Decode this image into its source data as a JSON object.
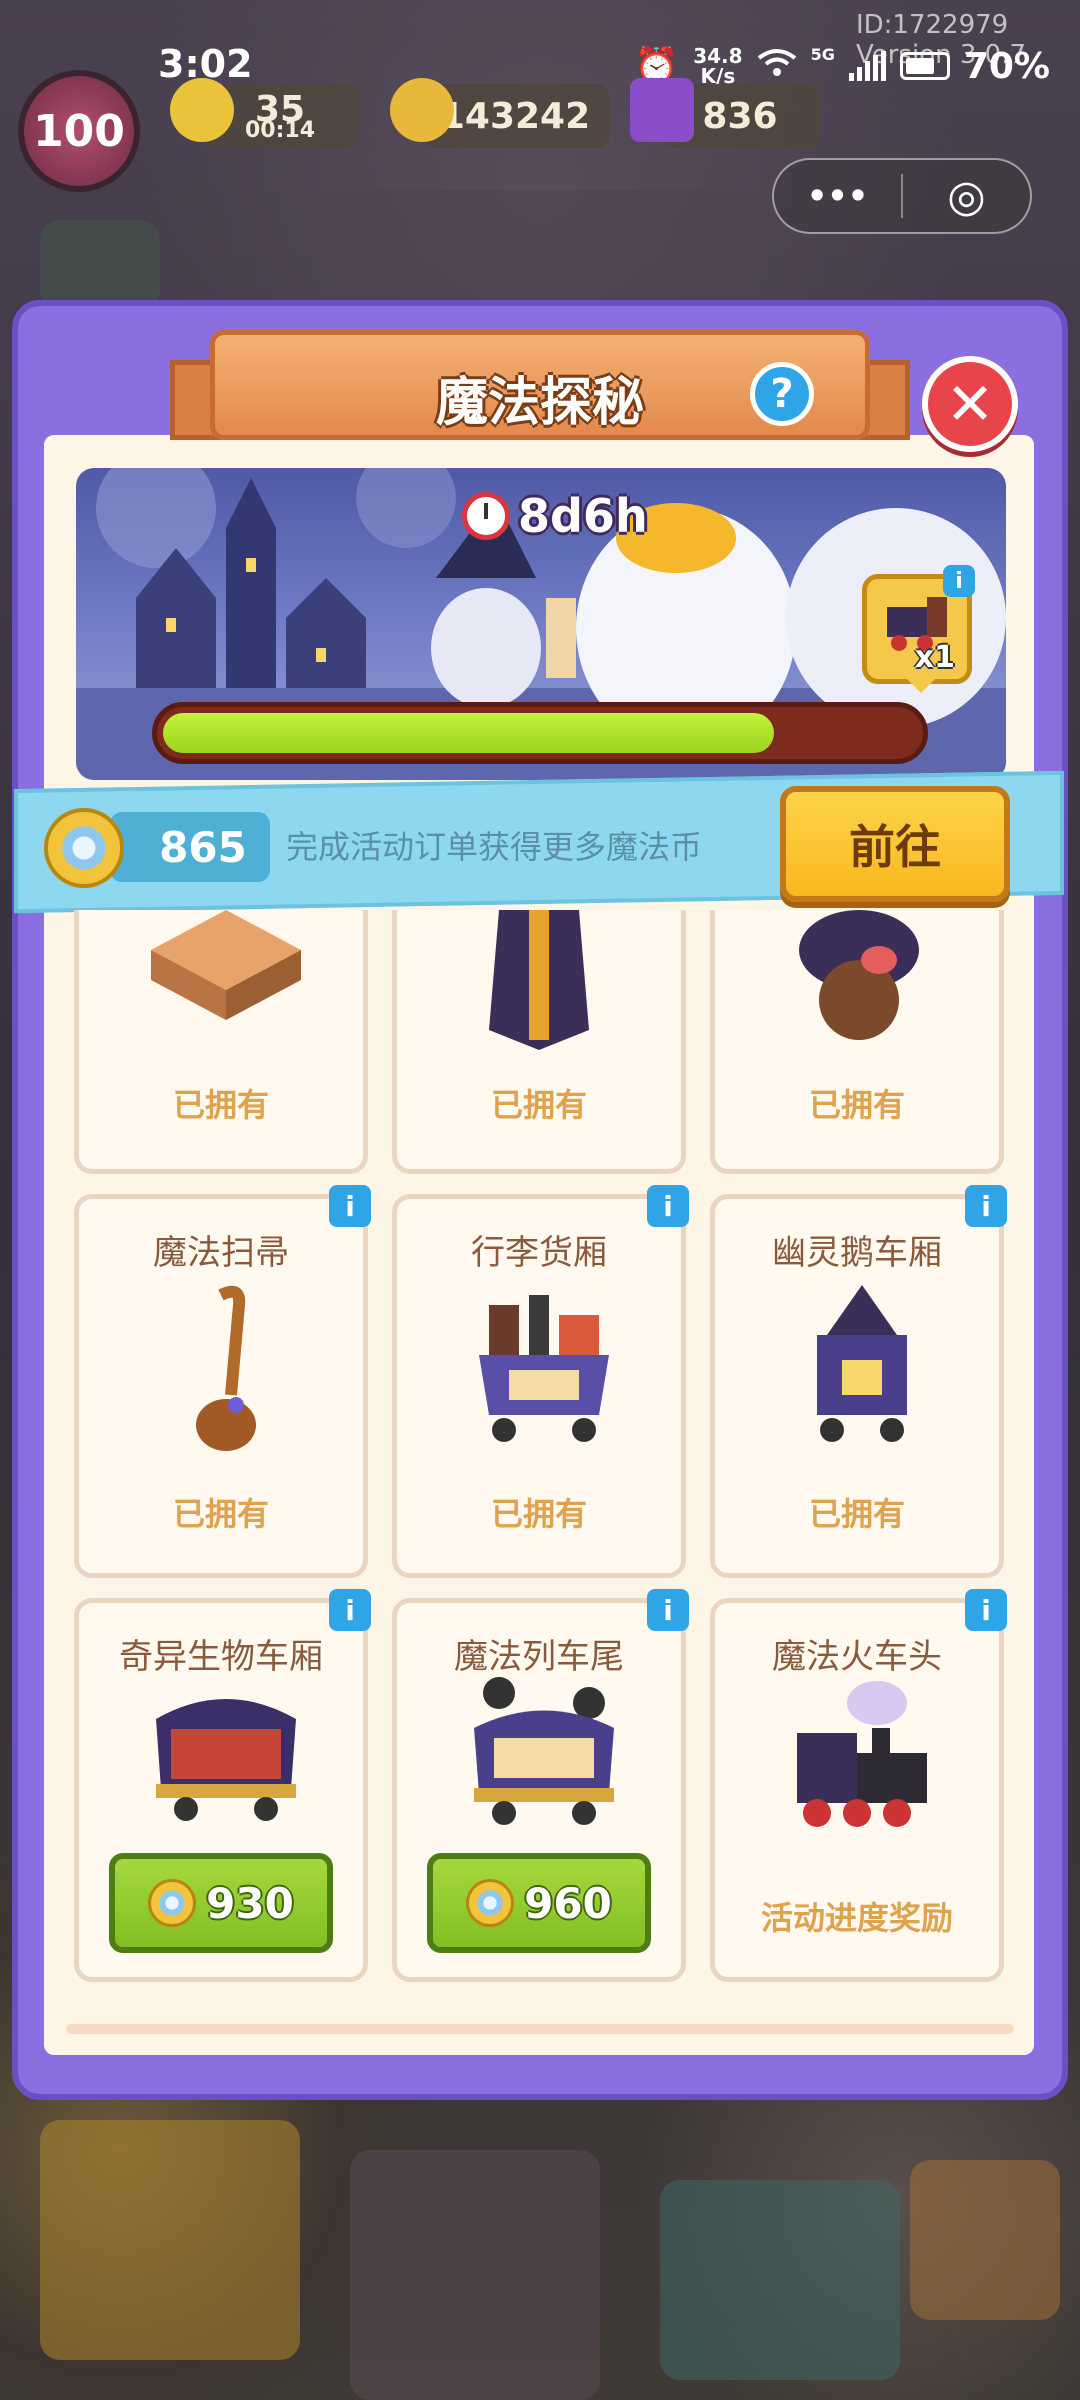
{
  "status_bar": {
    "time": "3:02",
    "net_speed_value": "34.8",
    "net_speed_unit": "K/s",
    "signal_label": "5G",
    "battery": "70%",
    "id_text": "ID:1722979",
    "version_text": "Version 3.0.7"
  },
  "resources": {
    "level": "100",
    "energy_value": "35",
    "energy_timer": "00:14",
    "coins_value": "143242",
    "gems_value": "836"
  },
  "panel": {
    "title": "魔法探秘",
    "help_label": "?",
    "close_label": "✕",
    "timer": "8d6h",
    "reward_count": "x1",
    "progress_fraction": 0.81,
    "currency_amount": "865",
    "currency_hint": "完成活动订单获得更多魔法币",
    "go_button": "前往"
  },
  "items": [
    {
      "name": "",
      "status": "已拥有"
    },
    {
      "name": "",
      "status": "已拥有"
    },
    {
      "name": "",
      "status": "已拥有"
    },
    {
      "name": "魔法扫帚",
      "status": "已拥有"
    },
    {
      "name": "行李货厢",
      "status": "已拥有"
    },
    {
      "name": "幽灵鹅车厢",
      "status": "已拥有"
    },
    {
      "name": "奇异生物车厢",
      "price": "930"
    },
    {
      "name": "魔法列车尾",
      "price": "960"
    },
    {
      "name": "魔法火车头",
      "status": "活动进度奖励"
    }
  ],
  "info_label": "i",
  "capsule": {
    "more_icon": "•••",
    "target_icon": "◎"
  },
  "colors": {
    "panel_purple": "#8b6ee0",
    "accent_orange": "#e3894d",
    "progress_green": "#9ad41e",
    "buy_green": "#83bf24",
    "go_yellow": "#f7b81e"
  }
}
